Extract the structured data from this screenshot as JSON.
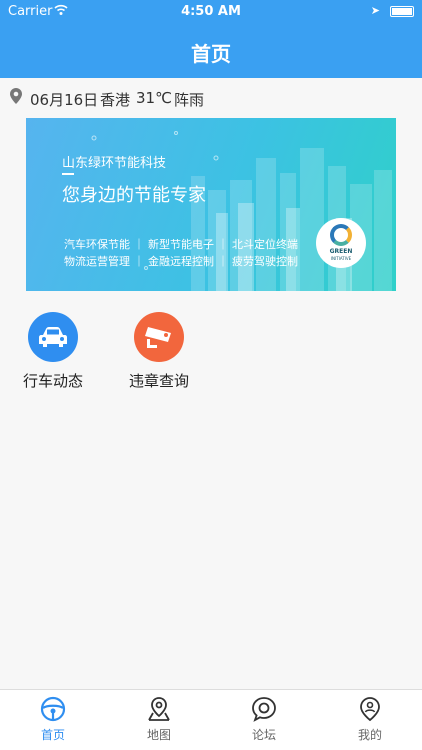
{
  "status_bar": {
    "carrier": "Carrier",
    "time": "4:50 AM"
  },
  "header": {
    "title": "首页"
  },
  "weather": {
    "date": "06月16日",
    "city": "香港",
    "temperature": "31℃",
    "condition": "阵雨"
  },
  "banner": {
    "company": "山东绿环节能科技",
    "slogan": "您身边的节能专家",
    "services_line1": "汽车环保节能 ｜ 新型节能电子 ｜ 北斗定位终端",
    "services_line2": "物流运营管理 ｜ 金融远程控制 ｜ 疲劳驾驶控制",
    "logo_text_top": "GREEN",
    "logo_text_bottom": "INITIATIVE"
  },
  "tools": [
    {
      "label": "行车动态",
      "icon": "car-icon",
      "color": "#2f8ef0"
    },
    {
      "label": "违章查询",
      "icon": "camera-icon",
      "color": "#f2663d"
    }
  ],
  "tabs": [
    {
      "label": "首页",
      "icon": "steering-wheel-icon",
      "active": true
    },
    {
      "label": "地图",
      "icon": "map-pin-icon",
      "active": false
    },
    {
      "label": "论坛",
      "icon": "chat-bubble-icon",
      "active": false
    },
    {
      "label": "我的",
      "icon": "profile-pin-icon",
      "active": false
    }
  ],
  "colors": {
    "primary": "#3aa0f2",
    "accent": "#2f8ef0",
    "alert": "#f2663d"
  }
}
